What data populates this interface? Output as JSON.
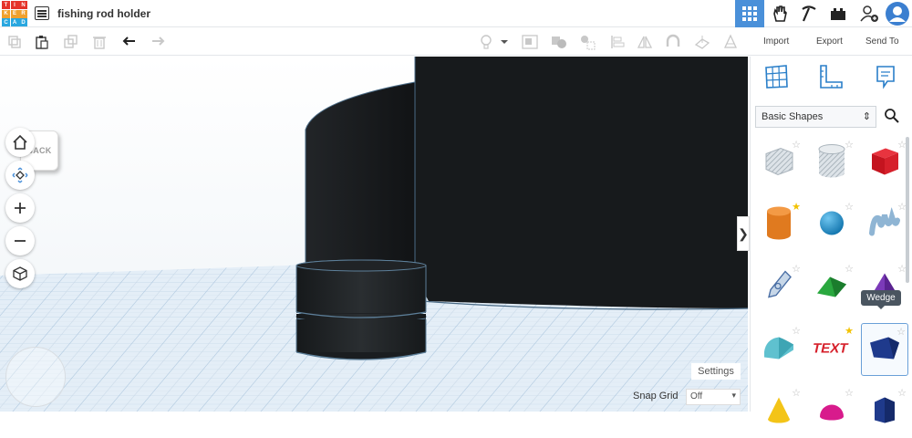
{
  "app": {
    "logo_letters": [
      "T",
      "I",
      "N",
      "K",
      "E",
      "R",
      "C",
      "A",
      "D"
    ],
    "logo_colors": [
      "#e5332a",
      "#e5332a",
      "#e5332a",
      "#f0a12e",
      "#f0a12e",
      "#f0a12e",
      "#2aa7df",
      "#2aa7df",
      "#2aa7df"
    ],
    "document_title": "fishing rod holder",
    "accent_color": "#4a90d9"
  },
  "topbar": {
    "buttons": [
      {
        "name": "3d-design-view",
        "icon": "grid-icon",
        "active": true
      },
      {
        "name": "blocks-view",
        "icon": "hand-icon"
      },
      {
        "name": "tools-view",
        "icon": "pickaxe-icon"
      },
      {
        "name": "bricks-view",
        "icon": "briefcase-icon"
      },
      {
        "name": "add-user",
        "icon": "add-user-icon"
      },
      {
        "name": "profile",
        "icon": "avatar-icon"
      }
    ]
  },
  "toolbar": {
    "import_label": "Import",
    "export_label": "Export",
    "sendto_label": "Send To"
  },
  "viewcube": {
    "label": "BACK"
  },
  "workplane": {
    "settings_label": "Settings",
    "snap_grid_label": "Snap Grid",
    "snap_grid_value": "Off"
  },
  "panel": {
    "shapes_category": "Basic Shapes",
    "tooltip": "Wedge",
    "shapes": [
      {
        "name": "box-hole",
        "fav": false
      },
      {
        "name": "cylinder-hole",
        "fav": false
      },
      {
        "name": "box",
        "fav": false
      },
      {
        "name": "cylinder",
        "fav": true
      },
      {
        "name": "sphere",
        "fav": false
      },
      {
        "name": "scribble",
        "fav": false
      },
      {
        "name": "shape-generator",
        "fav": false
      },
      {
        "name": "roof",
        "fav": false
      },
      {
        "name": "pyramid",
        "fav": false
      },
      {
        "name": "round-roof",
        "fav": false
      },
      {
        "name": "text",
        "fav": true
      },
      {
        "name": "wedge",
        "fav": false,
        "selected": true
      },
      {
        "name": "cone",
        "fav": false
      },
      {
        "name": "half-sphere",
        "fav": false
      },
      {
        "name": "polygon",
        "fav": false
      }
    ]
  }
}
